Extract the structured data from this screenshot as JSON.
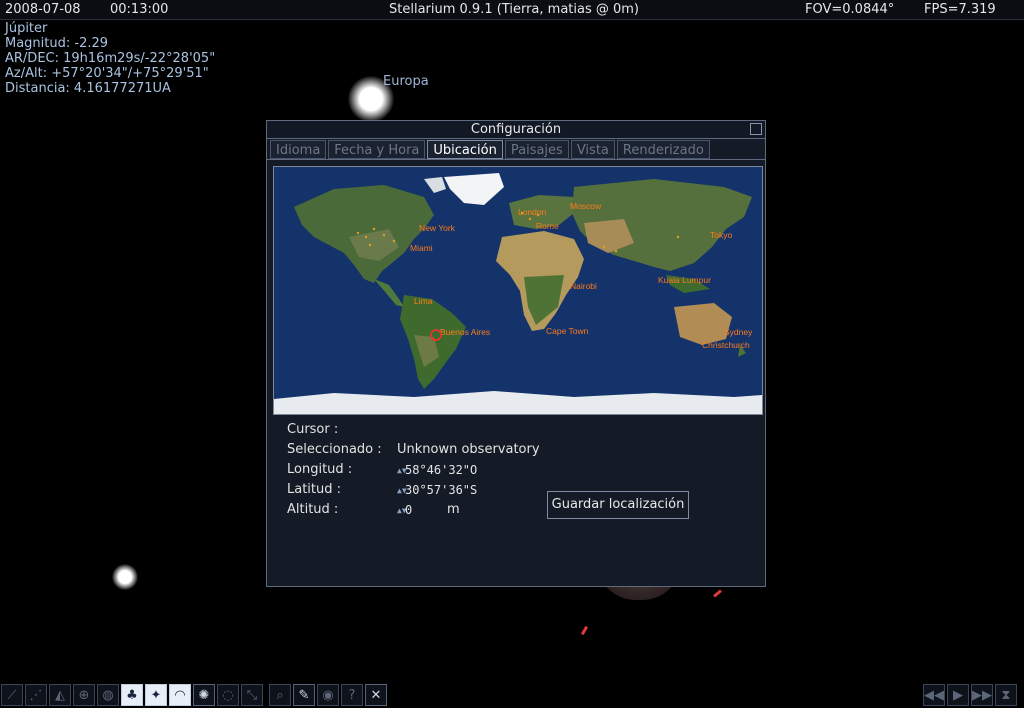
{
  "topbar": {
    "date": "2008-07-08",
    "time": "00:13:00",
    "title": "Stellarium 0.9.1 (Tierra, matias @ 0m)",
    "fov": "FOV=0.0844°",
    "fps": "FPS=7.319"
  },
  "object_info": {
    "name": "Júpiter",
    "magnitude": "Magnitud: -2.29",
    "radec": "AR/DEC: 19h16m29s/-22°28'05\"",
    "azalt": "Az/Alt: +57°20'34\"/+75°29'51\"",
    "distance": "Distancia: 4.16177271UA"
  },
  "sky_labels": {
    "europa": "Europa"
  },
  "dialog": {
    "title": "Configuración",
    "tabs": [
      {
        "label": "Idioma",
        "active": false
      },
      {
        "label": "Fecha y Hora",
        "active": false
      },
      {
        "label": "Ubicación",
        "active": true
      },
      {
        "label": "Paisajes",
        "active": false
      },
      {
        "label": "Vista",
        "active": false
      },
      {
        "label": "Renderizado",
        "active": false
      }
    ],
    "map_cities": [
      "Moscow",
      "London",
      "Rome",
      "New York",
      "Miami",
      "Tokyo",
      "Kuala Lumpur",
      "Nairobi",
      "Lima",
      "Buenos Aires",
      "Cape Town",
      "Sydney",
      "Christchurch"
    ],
    "cursor_label": "Cursor :",
    "selected_label": "Seleccionado :",
    "selected_value": "Unknown observatory",
    "longitude_label": "Longitud :",
    "longitude_value": "58°46'32\"O",
    "latitude_label": "Latitud :",
    "latitude_value": "30°57'36\"S",
    "altitude_label": "Altitud :",
    "altitude_value": "0",
    "altitude_unit": "m",
    "save_button": "Guardar localización"
  },
  "toolbar_left": [
    {
      "icon": "constellation-lines-icon",
      "active": false
    },
    {
      "icon": "constellation-names-icon",
      "active": false
    },
    {
      "icon": "constellation-art-icon",
      "active": false
    },
    {
      "icon": "equatorial-grid-icon",
      "active": false
    },
    {
      "icon": "azimuthal-grid-icon",
      "active": false
    },
    {
      "icon": "ground-icon",
      "active": true
    },
    {
      "icon": "cardinal-points-icon",
      "active": true
    },
    {
      "icon": "atmosphere-icon",
      "active": true
    },
    {
      "icon": "nebulas-icon",
      "active": true
    },
    {
      "icon": "planet-hints-icon",
      "active": false
    },
    {
      "icon": "equatorial-mount-icon",
      "active": false
    },
    {
      "icon": "search-icon",
      "active": false
    },
    {
      "icon": "configuration-icon",
      "active": false
    },
    {
      "icon": "night-mode-icon",
      "active": false
    },
    {
      "icon": "help-icon",
      "active": false
    },
    {
      "icon": "quit-icon",
      "active": false
    }
  ],
  "toolbar_right": [
    {
      "icon": "decrease-time-speed-icon"
    },
    {
      "icon": "real-time-speed-icon"
    },
    {
      "icon": "increase-time-speed-icon"
    },
    {
      "icon": "return-to-current-time-icon"
    }
  ],
  "colors": {
    "map_city": "#ff7a1a",
    "sky_label": "#9fb6d6",
    "active_tab_text": "#ffffff"
  }
}
